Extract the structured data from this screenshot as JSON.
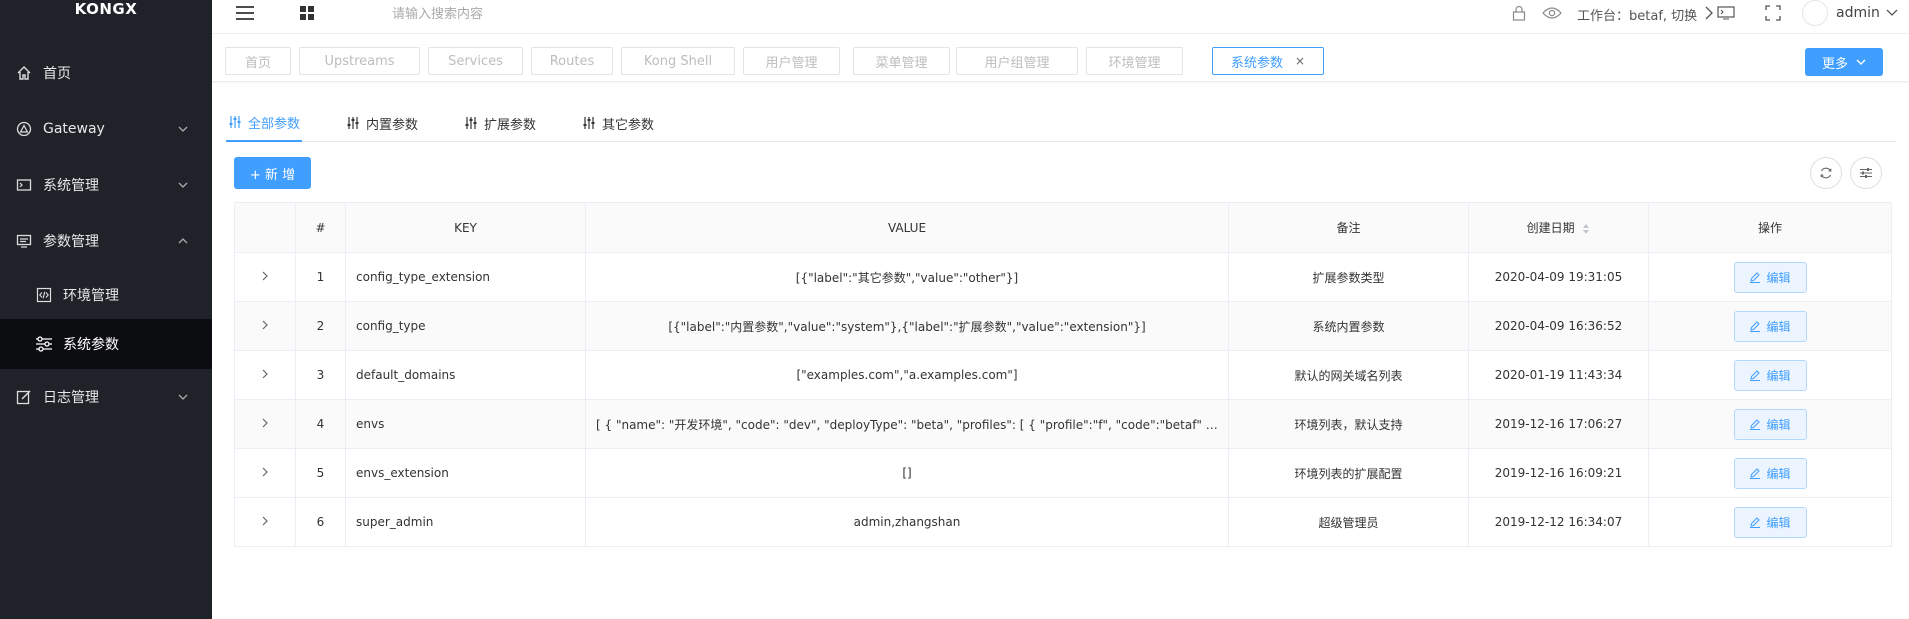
{
  "app": {
    "logo": "KONGX"
  },
  "sidebar": {
    "items": [
      {
        "label": "首页",
        "icon": "home-icon"
      },
      {
        "label": "Gateway",
        "icon": "gateway-icon",
        "expandable": true
      },
      {
        "label": "系统管理",
        "icon": "terminal-icon",
        "expandable": true
      },
      {
        "label": "参数管理",
        "icon": "params-icon",
        "expandable": true,
        "expanded": true
      },
      {
        "label": "环境管理",
        "icon": "code-icon",
        "sub": true
      },
      {
        "label": "系统参数",
        "icon": "sliders-icon",
        "sub": true,
        "active": true
      },
      {
        "label": "日志管理",
        "icon": "edit-log-icon",
        "expandable": true
      }
    ]
  },
  "topbar": {
    "search_placeholder": "请输入搜索内容",
    "workspace": "工作台：betaf, 切换",
    "user": "admin"
  },
  "tabs": {
    "items": [
      "首页",
      "Upstreams",
      "Services",
      "Routes",
      "Kong Shell",
      "用户管理",
      "菜单管理",
      "用户组管理",
      "环境管理",
      "系统参数"
    ],
    "active": "系统参数",
    "close": "×",
    "more": "更多"
  },
  "subtabs": [
    "全部参数",
    "内置参数",
    "扩展参数",
    "其它参数"
  ],
  "toolbar": {
    "add_label": "+ 新 增"
  },
  "table": {
    "columns": [
      "#",
      "KEY",
      "VALUE",
      "备注",
      "创建日期",
      "操作"
    ],
    "edit_label": "编辑",
    "rows": [
      {
        "no": "1",
        "key": "config_type_extension",
        "value": "[{\"label\":\"其它参数\",\"value\":\"other\"}]",
        "remark": "扩展参数类型",
        "date": "2020-04-09 19:31:05"
      },
      {
        "no": "2",
        "key": "config_type",
        "value": "[{\"label\":\"内置参数\",\"value\":\"system\"},{\"label\":\"扩展参数\",\"value\":\"extension\"}]",
        "remark": "系统内置参数",
        "date": "2020-04-09 16:36:52"
      },
      {
        "no": "3",
        "key": "default_domains",
        "value": "[\"examples.com\",\"a.examples.com\"]",
        "remark": "默认的网关域名列表",
        "date": "2020-01-19 11:43:34"
      },
      {
        "no": "4",
        "key": "envs",
        "value": "[ { \"name\": \"开发环境\", \"code\": \"dev\", \"deployType\": \"beta\", \"profiles\": [ { \"profile\":\"f\", \"code\":\"betaf\" } ] }, { \"name\": \"…",
        "remark": "环境列表，默认支持",
        "date": "2019-12-16 17:06:27"
      },
      {
        "no": "5",
        "key": "envs_extension",
        "value": "[]",
        "remark": "环境列表的扩展配置",
        "date": "2019-12-16 16:09:21"
      },
      {
        "no": "6",
        "key": "super_admin",
        "value": "admin,zhangshan",
        "remark": "超级管理员",
        "date": "2019-12-12 16:34:07"
      }
    ]
  },
  "colors": {
    "accent": "#409eff",
    "sidebar_bg": "#1f2229",
    "sidebar_active": "#0c0d10"
  }
}
